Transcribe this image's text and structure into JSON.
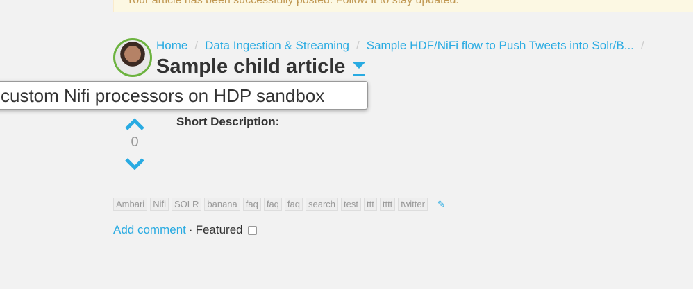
{
  "banner": "Your article has been successfully posted. Follow it to stay updated.",
  "breadcrumb": [
    "Home",
    "Data Ingestion & Streaming",
    "Sample HDF/NiFi flow to Push Tweets into Solr/B..."
  ],
  "title": "Sample child article",
  "tooltip": "custom Nifi processors on HDP sandbox",
  "vote_count": "0",
  "short_description_label": "Short Description:",
  "tags": [
    "Ambari",
    "Nifi",
    "SOLR",
    "banana",
    "faq",
    "faq",
    "faq",
    "search",
    "test",
    "ttt",
    "tttt",
    "twitter"
  ],
  "add_comment": "Add comment",
  "separator": "·",
  "featured": "Featured"
}
